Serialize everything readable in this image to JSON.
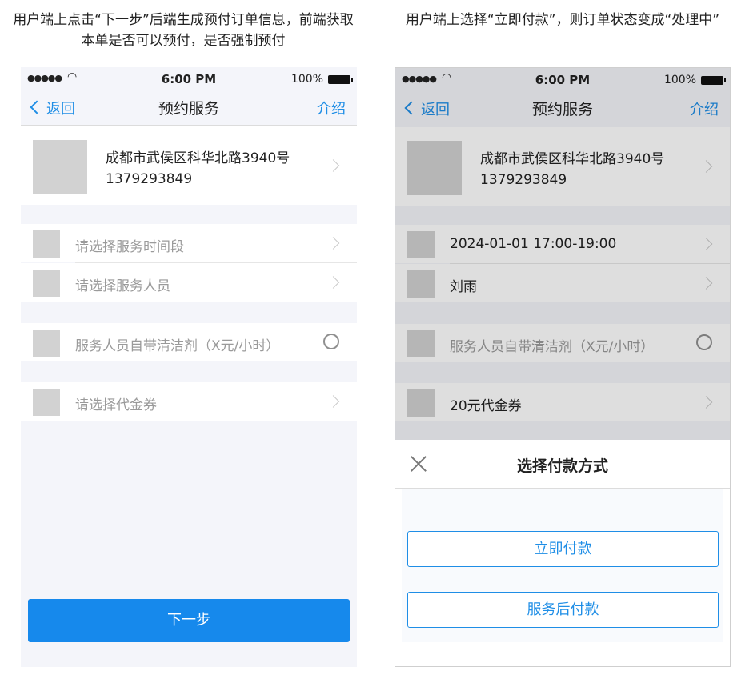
{
  "captions": {
    "left": "用户端上点击“下一步”后端生成预付订单信息，前端获取本单是否可以预付，是否强制预付",
    "right": "用户端上选择“立即付款”，则订单状态变成“处理中”"
  },
  "status_bar": {
    "signal": "●●●●●",
    "time": "6:00 PM",
    "battery": "100%"
  },
  "navbar": {
    "back": "返回",
    "title": "预约服务",
    "right": "介绍"
  },
  "address": {
    "line1": "成都市武侯区科华北路3940号",
    "phone": "1379293849"
  },
  "screen1": {
    "time_placeholder": "请选择服务时间段",
    "staff_placeholder": "请选择服务人员",
    "detergent_option": "服务人员自带清洁剂（X元/小时）",
    "coupon_placeholder": "请选择代金券",
    "next_button": "下一步"
  },
  "screen2": {
    "time_value": "2024-01-01 17:00-19:00",
    "staff_value": "刘雨",
    "detergent_option": "服务人员自带清洁剂（X元/小时）",
    "coupon_value": "20元代金券",
    "sheet_title": "选择付款方式",
    "pay_now": "立即付款",
    "pay_later": "服务后付款"
  },
  "colors": {
    "accent": "#1f8ee6",
    "primary_button": "#1689ec",
    "placeholder": "#d2d2d2"
  }
}
